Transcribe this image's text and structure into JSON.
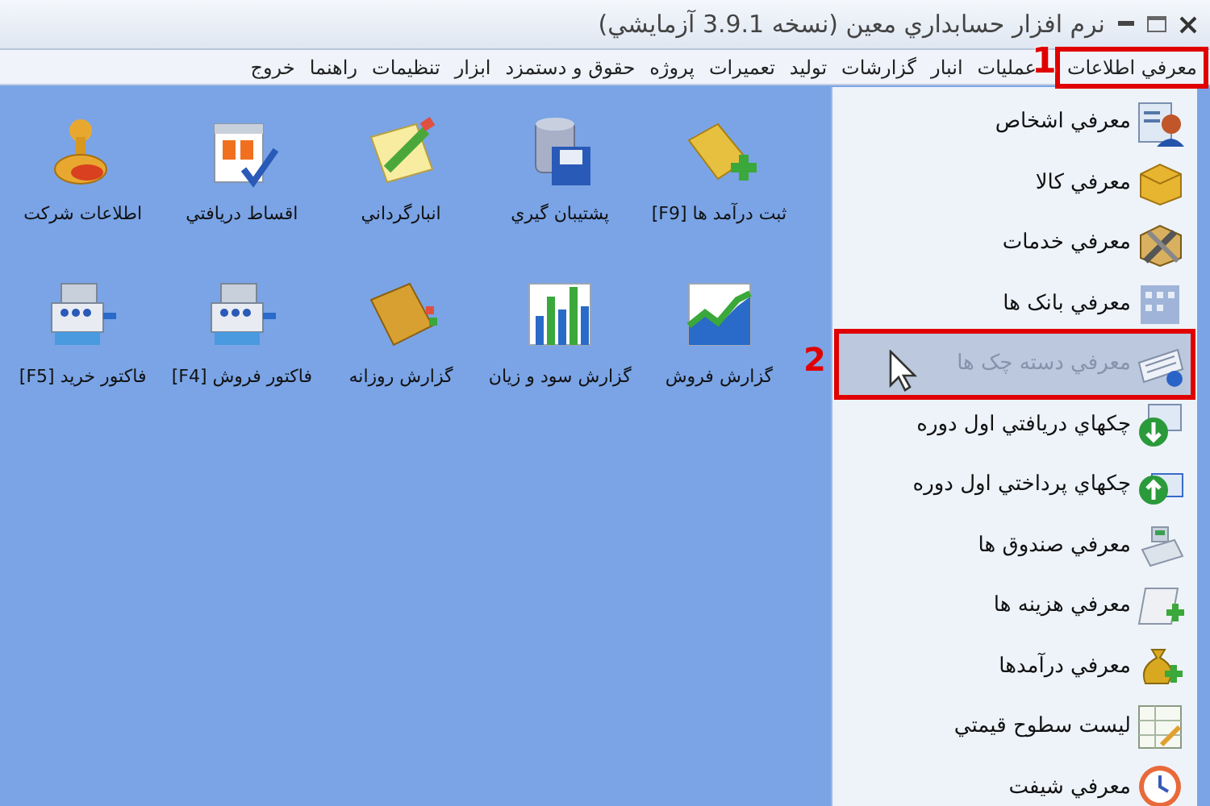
{
  "window": {
    "title": "نرم افزار حسابداري معين (نسخه 3.9.1 آزمايشي)"
  },
  "menu": {
    "items": [
      {
        "label": "معرفي اطلاعات",
        "annotation": "1"
      },
      {
        "label": "عمليات"
      },
      {
        "label": "انبار"
      },
      {
        "label": "گزارشات"
      },
      {
        "label": "توليد"
      },
      {
        "label": "تعميرات"
      },
      {
        "label": "پروژه"
      },
      {
        "label": "حقوق و دستمزد"
      },
      {
        "label": "ابزار"
      },
      {
        "label": "تنظيمات"
      },
      {
        "label": "راهنما"
      },
      {
        "label": "خروج"
      }
    ]
  },
  "shortcuts": [
    {
      "label": "ثبت درآمد ها [F9]"
    },
    {
      "label": "پشتيبان گيري"
    },
    {
      "label": "انبارگرداني"
    },
    {
      "label": "اقساط دريافتي"
    },
    {
      "label": "اطلاعات شركت"
    },
    {
      "label": "گزارش فروش"
    },
    {
      "label": "گزارش سود و زيان"
    },
    {
      "label": "گزارش روزانه"
    },
    {
      "label": "فاكتور فروش [F4]"
    },
    {
      "label": "فاكتور خريد [F5]"
    }
  ],
  "sidebar": {
    "items": [
      {
        "label": "معرفي اشخاص",
        "selected": false
      },
      {
        "label": "معرفي كالا",
        "selected": false
      },
      {
        "label": "معرفي خدمات",
        "selected": false
      },
      {
        "label": "معرفي بانک ها",
        "selected": false
      },
      {
        "label": "معرفي دسته چک ها",
        "selected": true,
        "annotation": "2"
      },
      {
        "label": "چكهاي دريافتي اول دوره",
        "selected": false
      },
      {
        "label": "چكهاي پرداختي اول دوره",
        "selected": false
      },
      {
        "label": "معرفي صندوق ها",
        "selected": false
      },
      {
        "label": "معرفي هزينه ها",
        "selected": false
      },
      {
        "label": "معرفي درآمدها",
        "selected": false
      },
      {
        "label": "ليست سطوح قيمتي",
        "selected": false
      },
      {
        "label": "معرفي شيفت",
        "selected": false
      }
    ]
  }
}
